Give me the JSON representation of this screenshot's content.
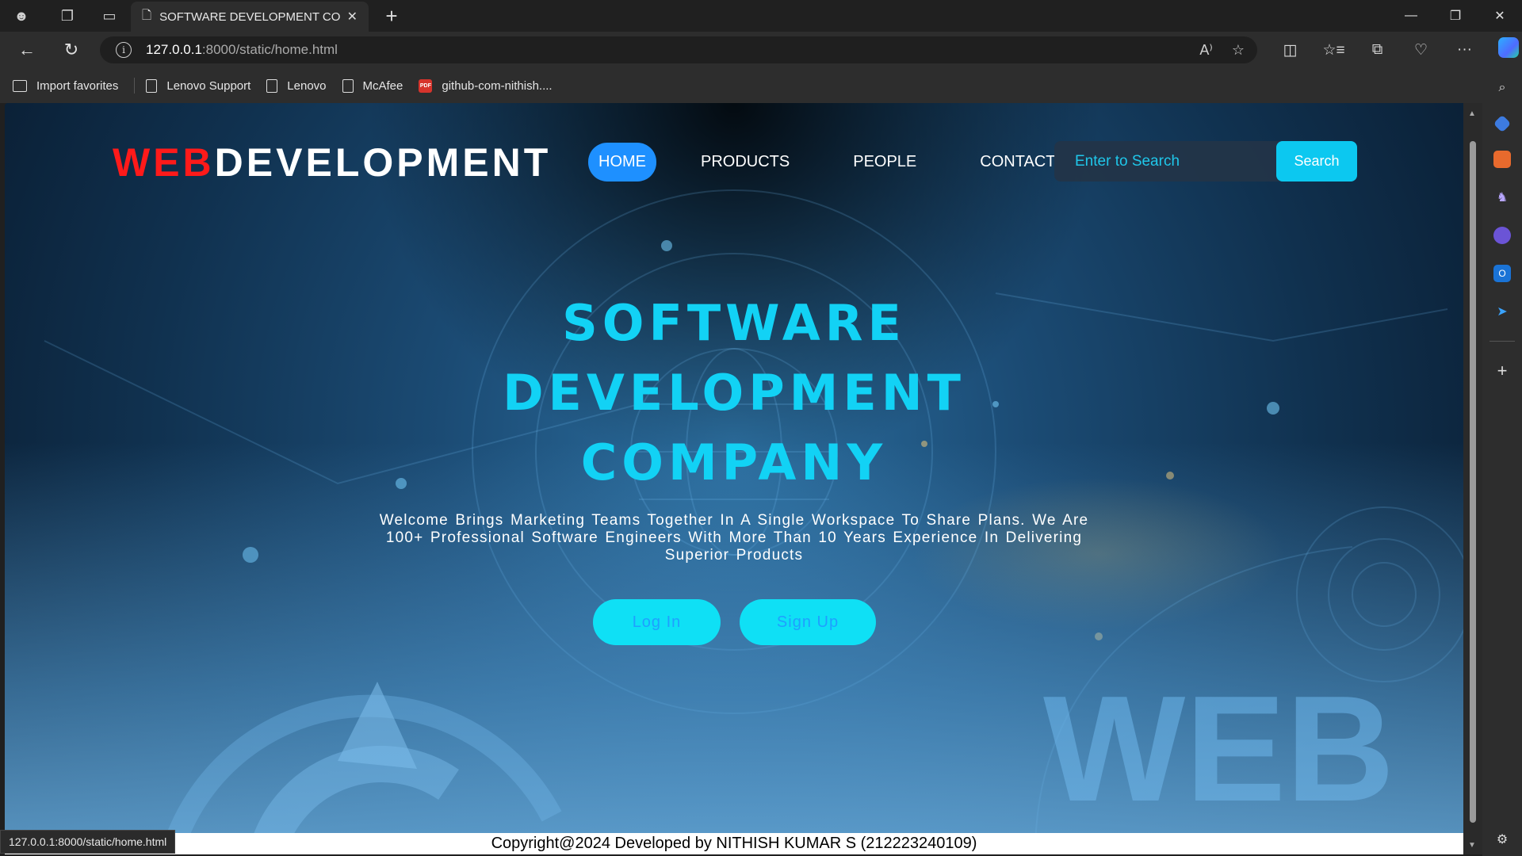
{
  "browser": {
    "tab_title": "SOFTWARE DEVELOPMENT COMPANY",
    "url_host": "127.0.0.1",
    "url_path": ":8000/static/home.html",
    "status_url": "127.0.0.1:8000/static/home.html",
    "favorites": [
      {
        "label": "Import favorites"
      },
      {
        "label": "Lenovo Support"
      },
      {
        "label": "Lenovo"
      },
      {
        "label": "McAfee"
      },
      {
        "label": "github-com-nithish...."
      }
    ]
  },
  "site": {
    "brand_red": "WEB",
    "brand_white": "DEVELOPMENT",
    "nav": [
      {
        "label": "HOME",
        "active": true
      },
      {
        "label": "PRODUCTS"
      },
      {
        "label": "PEOPLE"
      },
      {
        "label": "CONTACT"
      }
    ],
    "search": {
      "placeholder": "Enter to Search",
      "button_label": "Search"
    },
    "hero": {
      "title_lines": [
        "SOFTWARE",
        "DEVELOPMENT",
        "COMPANY"
      ],
      "text": "Welcome Brings Marketing Teams Together In A Single Workspace To Share Plans. We Are 100+ Professional Software Engineers With More Than 10 Years Experience In Delivering Superior Products",
      "login_label": "Log In",
      "signup_label": "Sign Up"
    },
    "background_text": "WEB",
    "footer": "Copyright@2024 Developed by NITHISH KUMAR S (212223240109)"
  },
  "colors": {
    "brand_red": "#ff1a1a",
    "accent_cyan": "#12d2f5",
    "nav_active": "#1e90ff",
    "button_cyan": "#0fe0f5"
  }
}
